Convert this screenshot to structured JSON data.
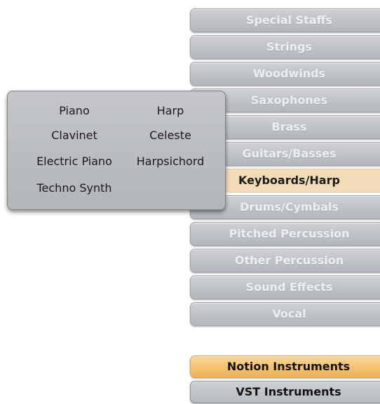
{
  "categories": [
    {
      "label": "Special Staffs"
    },
    {
      "label": "Strings"
    },
    {
      "label": "Woodwinds"
    },
    {
      "label": "Saxophones"
    },
    {
      "label": "Brass"
    },
    {
      "label": "Guitars/Basses"
    },
    {
      "label": "Keyboards/Harp",
      "selected": true
    },
    {
      "label": "Drums/Cymbals"
    },
    {
      "label": "Pitched Percussion"
    },
    {
      "label": "Other Percussion"
    },
    {
      "label": "Sound Effects"
    },
    {
      "label": "Vocal"
    }
  ],
  "instruments": [
    {
      "label": "Piano"
    },
    {
      "label": "Harp"
    },
    {
      "label": "Clavinet"
    },
    {
      "label": "Celeste"
    },
    {
      "label": "Electric Piano"
    },
    {
      "label": "Harpsichord"
    },
    {
      "label": "Techno Synth"
    }
  ],
  "sources": {
    "notion": "Notion Instruments",
    "vst": "VST Instruments"
  },
  "colors": {
    "selected_category": "#f2dbb8",
    "category_button": "#bec1c5",
    "category_text": "#eceff2",
    "notion_button": "#f4bf6c",
    "popup_background": "#b9bcc0"
  }
}
